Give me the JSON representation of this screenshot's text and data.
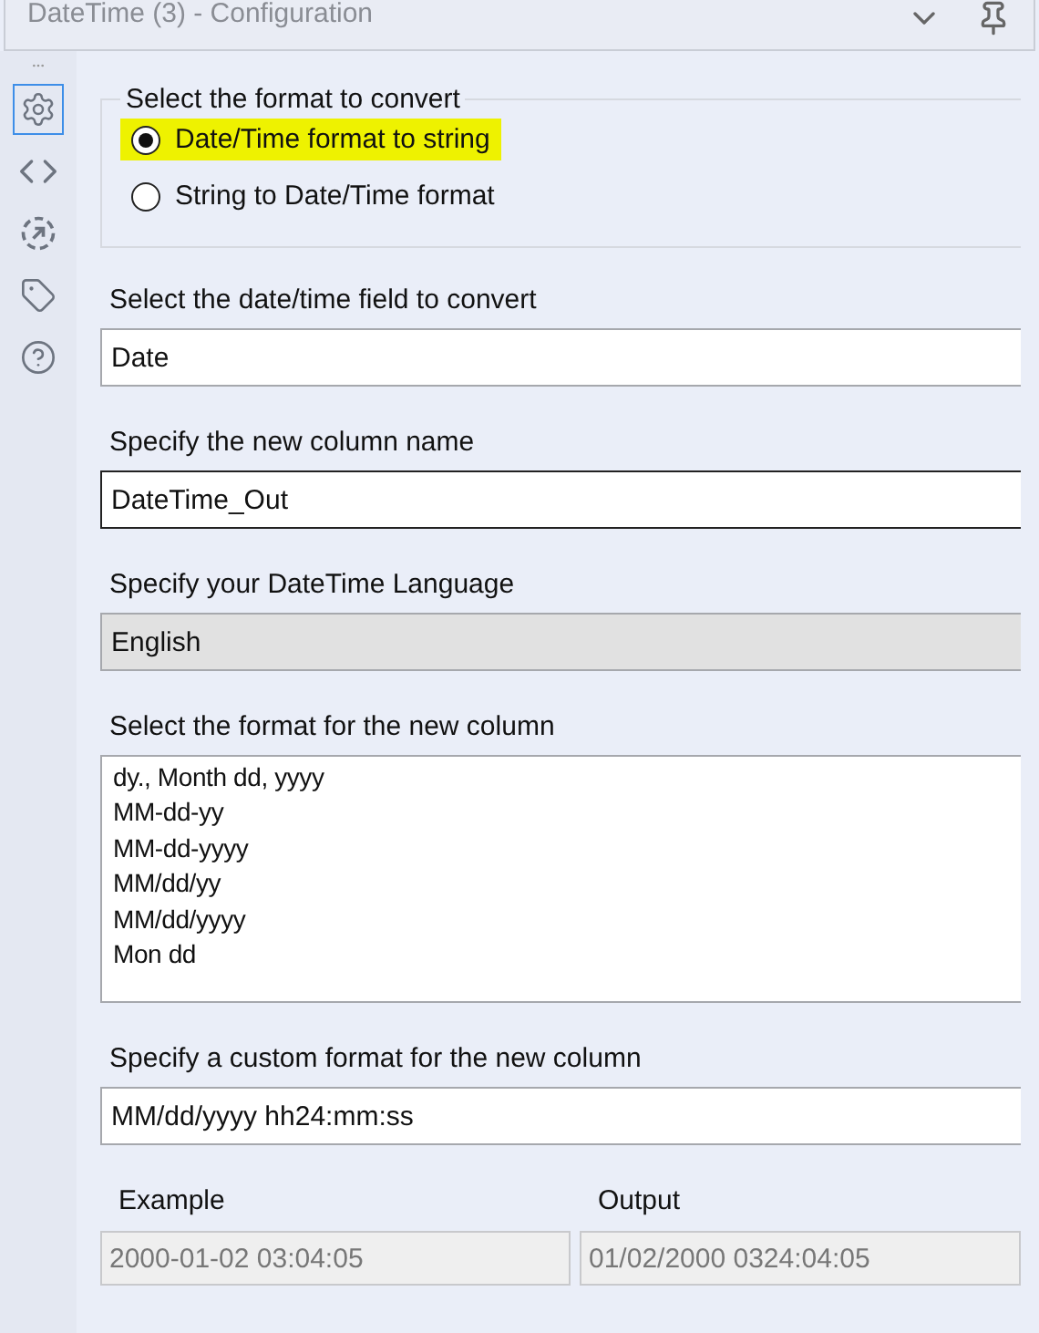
{
  "window": {
    "title": "DateTime (3) - Configuration"
  },
  "sidebar": {
    "items": [
      {
        "kind": "settings",
        "selected": true
      },
      {
        "kind": "code",
        "selected": false
      },
      {
        "kind": "output",
        "selected": false
      },
      {
        "kind": "tag",
        "selected": false
      },
      {
        "kind": "help",
        "selected": false
      }
    ]
  },
  "format_group": {
    "title": "Select the format to convert",
    "options": [
      {
        "label": "Date/Time format to string",
        "selected": true,
        "highlighted": true
      },
      {
        "label": "String to Date/Time format",
        "selected": false,
        "highlighted": false
      }
    ]
  },
  "field_select": {
    "label": "Select the date/time field to convert",
    "value": "Date"
  },
  "column_name": {
    "label": "Specify the new column name",
    "value": "DateTime_Out"
  },
  "language": {
    "label": "Specify your DateTime Language",
    "value": "English",
    "disabled": true
  },
  "format_list": {
    "label": "Select the format for the new column",
    "items": [
      "dy., Month dd, yyyy",
      "MM-dd-yy",
      "MM-dd-yyyy",
      "MM/dd/yy",
      "MM/dd/yyyy",
      "Mon dd"
    ]
  },
  "custom_format": {
    "label": "Specify a custom format for the new column",
    "value": "MM/dd/yyyy hh24:mm:ss"
  },
  "preview": {
    "example_label": "Example",
    "example": "2000-01-02 03:04:05",
    "output_label": "Output",
    "output": "01/02/2000 0324:04:05"
  }
}
